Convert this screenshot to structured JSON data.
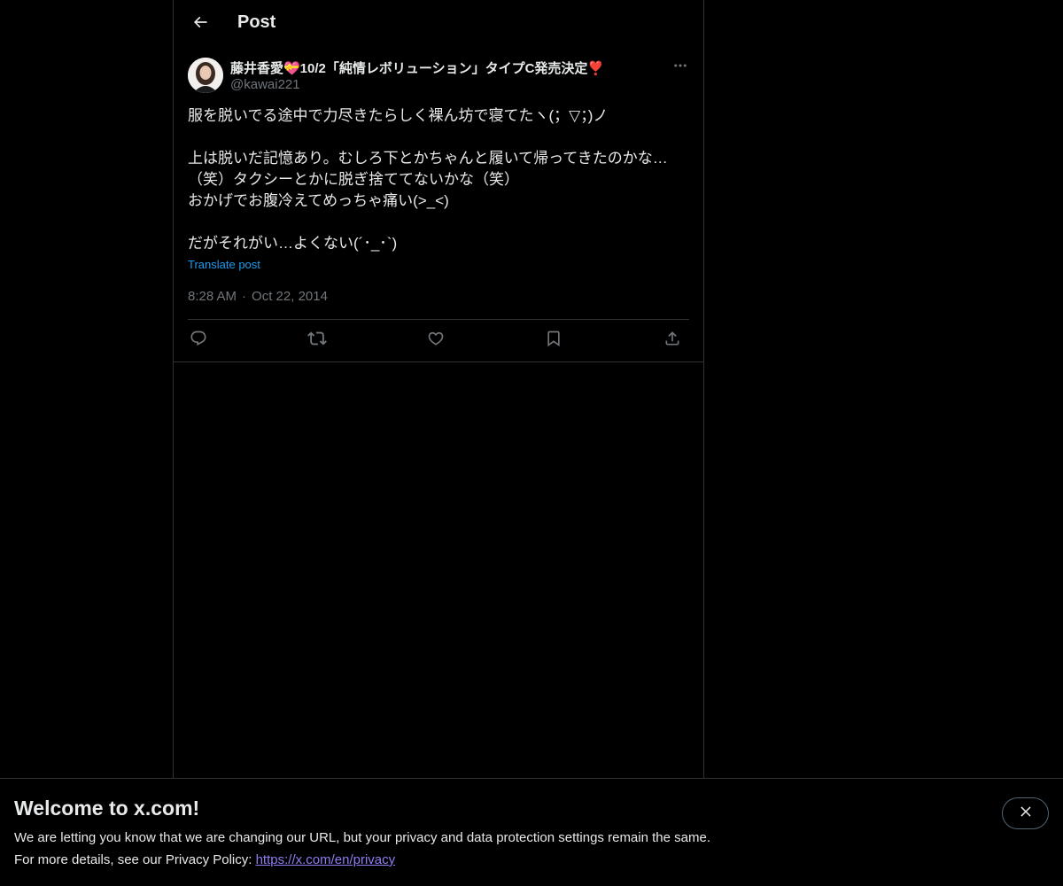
{
  "header": {
    "title": "Post"
  },
  "post": {
    "author": {
      "display_name": "藤井香愛💝10/2「純情レボリューション」タイプC発売決定❣️",
      "handle": "@kawai221"
    },
    "text_lines": [
      "服を脱いでる途中で力尽きたらしく裸ん坊で寝てたヽ(；▽；)ノ",
      "",
      "上は脱いだ記憶あり。むしろ下とかちゃんと履いて帰ってきたのかな…",
      "（笑）タクシーとかに脱ぎ捨ててないかな（笑）",
      "おかげでお腹冷えてめっちゃ痛い(>_<)",
      "",
      "だがそれがい…よくない(´･_･`)"
    ],
    "translate_label": "Translate post",
    "time": "8:28 AM",
    "separator": "·",
    "date": "Oct 22, 2014"
  },
  "actions": [
    "reply-icon",
    "repost-icon",
    "like-icon",
    "bookmark-icon",
    "share-icon"
  ],
  "banner": {
    "title": "Welcome to x.com!",
    "line1": "We are letting you know that we are changing our URL, but your privacy and data protection settings remain the same.",
    "line2_prefix": "For more details, see our Privacy Policy: ",
    "link": "https://x.com/en/privacy"
  },
  "colors": {
    "background": "#000000",
    "text": "#e7e9ea",
    "muted": "#71767b",
    "link": "#1d9bf0",
    "border": "#2f3336"
  }
}
